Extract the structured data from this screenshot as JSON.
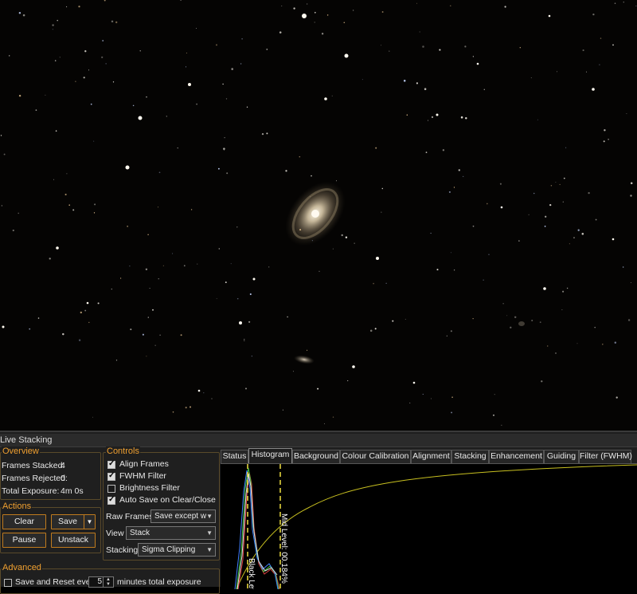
{
  "window_title": "Live Stacking",
  "overview": {
    "legend": "Overview",
    "frames_stacked_label": "Frames Stacked:",
    "frames_stacked_value": "4",
    "frames_rejected_label": "Frames Rejected:",
    "frames_rejected_value": "0",
    "total_exposure_label": "Total Exposure:",
    "total_exposure_value": "4m 0s"
  },
  "actions": {
    "legend": "Actions",
    "clear": "Clear",
    "save": "Save",
    "pause": "Pause",
    "unstack": "Unstack"
  },
  "controls": {
    "legend": "Controls",
    "align_frames": "Align Frames",
    "fwhm_filter": "FWHM Filter",
    "brightness_filter": "Brightness Filter",
    "auto_save": "Auto Save on Clear/Close",
    "raw_frames_label": "Raw Frames",
    "raw_frames_value": "Save except w",
    "view_label": "View",
    "view_value": "Stack",
    "stacking_label": "Stacking",
    "stacking_value": "Sigma Clipping"
  },
  "advanced": {
    "legend": "Advanced",
    "save_reset_label": "Save and Reset every",
    "save_reset_value": "5",
    "save_reset_suffix": "minutes total exposure"
  },
  "tabs": [
    "Status",
    "Histogram",
    "Background",
    "Colour Calibration",
    "Alignment",
    "Stacking",
    "Enhancement",
    "Guiding",
    "Filter (FWHM)"
  ],
  "histogram": {
    "black_level_label": "Black Level",
    "mid_level_label": "Mid Level: 00.184%"
  }
}
